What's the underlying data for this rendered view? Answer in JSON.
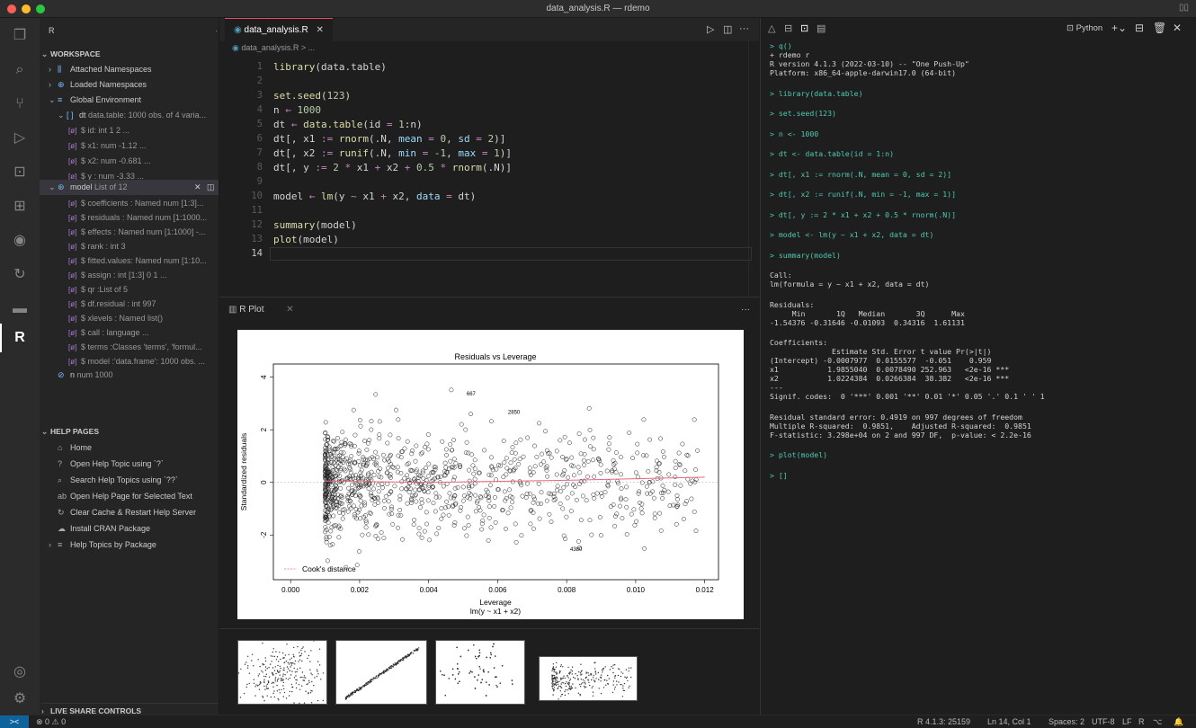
{
  "window": {
    "title": "data_analysis.R — rdemo",
    "traffic_colors": [
      "#ff5f57",
      "#febc2e",
      "#28c840"
    ]
  },
  "activity_bar": {
    "icons": [
      "files-icon",
      "search-icon",
      "source-control-icon",
      "run-debug-icon",
      "remote-explorer-icon",
      "extensions-icon",
      "github-icon",
      "live-share-icon",
      "docker-icon",
      "r-icon"
    ],
    "bottom_icons": [
      "account-icon",
      "settings-gear-icon"
    ]
  },
  "sidebar": {
    "title": "R",
    "more": "···",
    "workspace_header": "WORKSPACE",
    "attached": "Attached Namespaces",
    "loaded": "Loaded Namespaces",
    "global": "Global Environment",
    "dt": {
      "name": "dt",
      "desc": "data.table: 1000 obs. of 4 varia..."
    },
    "dt_fields": [
      "$ id: int 1 2 ...",
      "$ x1: num -1.12 ...",
      "$ x2: num -0.681 ...",
      "$ y : num -3.33 ..."
    ],
    "model": {
      "name": "model",
      "desc": "List of 12"
    },
    "model_fields": [
      "$ coefficients : Named num [1:3]...",
      "$ residuals : Named num [1:1000...",
      "$ effects : Named num [1:1000] -...",
      "$ rank : int 3",
      "$ fitted.values: Named num [1:10...",
      "$ assign : int [1:3] 0 1 ...",
      "$ qr :List of 5",
      "$ df.residual : int 997",
      "$ xlevels : Named list()",
      "$ call : language ...",
      "$ terms :Classes 'terms', 'formul...",
      "$ model :'data.frame': 1000 obs. ..."
    ],
    "n": {
      "name": "n",
      "desc": "num 1000"
    },
    "help_header": "HELP PAGES",
    "help_items": [
      "Home",
      "Open Help Topic using `?`",
      "Search Help Topics using `??`",
      "Open Help Page for Selected Text",
      "Clear Cache & Restart Help Server",
      "Install CRAN Package",
      "Help Topics by Package"
    ],
    "live_share": "LIVE SHARE CONTROLS"
  },
  "editor": {
    "tab": "data_analysis.R",
    "breadcrumb": "data_analysis.R > ...",
    "current_line": "14"
  },
  "plot": {
    "tab": "R Plot",
    "more": "···"
  },
  "chart_data": {
    "type": "scatter",
    "title": "Residuals vs Leverage",
    "xlabel": "Leverage",
    "xlabel2": "lm(y ~ x1 + x2)",
    "ylabel": "Standardized residuals",
    "xlim": [
      -0.0005,
      0.0124
    ],
    "ylim": [
      -3.7,
      4.5
    ],
    "xticks": [
      "0.000",
      "0.002",
      "0.004",
      "0.006",
      "0.008",
      "0.010",
      "0.012"
    ],
    "yticks": [
      "-2",
      "0",
      "2",
      "4"
    ],
    "legend": "Cook's distance",
    "labeled_points": [
      {
        "label": "667",
        "x": 0.0051,
        "y": 3.3
      },
      {
        "label": "2850",
        "x": 0.0063,
        "y": 2.6
      },
      {
        "label": "4380",
        "x": 0.0081,
        "y": -2.6
      }
    ],
    "n_points": 1000,
    "smoother": [
      [
        0.001,
        0.05
      ],
      [
        0.004,
        0.0
      ],
      [
        0.008,
        0.08
      ],
      [
        0.012,
        0.2
      ]
    ]
  },
  "terminal": {
    "shell": "Python",
    "lines": [
      "> q()",
      "+ rdemo r",
      "R version 4.1.3 (2022-03-10) -- \"One Push-Up\"",
      "Platform: x86_64-apple-darwin17.0 (64-bit)",
      "",
      "> library(data.table)",
      "",
      "> set.seed(123)",
      "",
      "> n <- 1000",
      "",
      "> dt <- data.table(id = 1:n)",
      "",
      "> dt[, x1 := rnorm(.N, mean = 0, sd = 2)]",
      "",
      "> dt[, x2 := runif(.N, min = -1, max = 1)]",
      "",
      "> dt[, y := 2 * x1 + x2 + 0.5 * rnorm(.N)]",
      "",
      "> model <- lm(y ~ x1 + x2, data = dt)",
      "",
      "> summary(model)",
      "",
      "Call:",
      "lm(formula = y ~ x1 + x2, data = dt)",
      "",
      "Residuals:",
      "     Min       1Q   Median       3Q      Max",
      "-1.54376 -0.31646 -0.01093  0.34316  1.61131",
      "",
      "Coefficients:",
      "              Estimate Std. Error t value Pr(>|t|)",
      "(Intercept) -0.0007977  0.0155577  -0.051    0.959",
      "x1           1.9855040  0.0078490 252.963   <2e-16 ***",
      "x2           1.0224384  0.0266384  38.382   <2e-16 ***",
      "---",
      "Signif. codes:  0 '***' 0.001 '**' 0.01 '*' 0.05 '.' 0.1 ' ' 1",
      "",
      "Residual standard error: 0.4919 on 997 degrees of freedom",
      "Multiple R-squared:  0.9851,    Adjusted R-squared:  0.9851",
      "F-statistic: 3.298e+04 on 2 and 997 DF,  p-value: < 2.2e-16",
      "",
      "> plot(model)",
      "",
      "> []"
    ]
  },
  "status": {
    "remote": "><",
    "problems": "⊗ 0 ⚠ 0",
    "r_version": "R 4.1.3: 25159",
    "position": "Ln 14, Col 1",
    "spaces": "Spaces: 2",
    "encoding": "UTF-8",
    "eol": "LF",
    "lang": "R"
  }
}
